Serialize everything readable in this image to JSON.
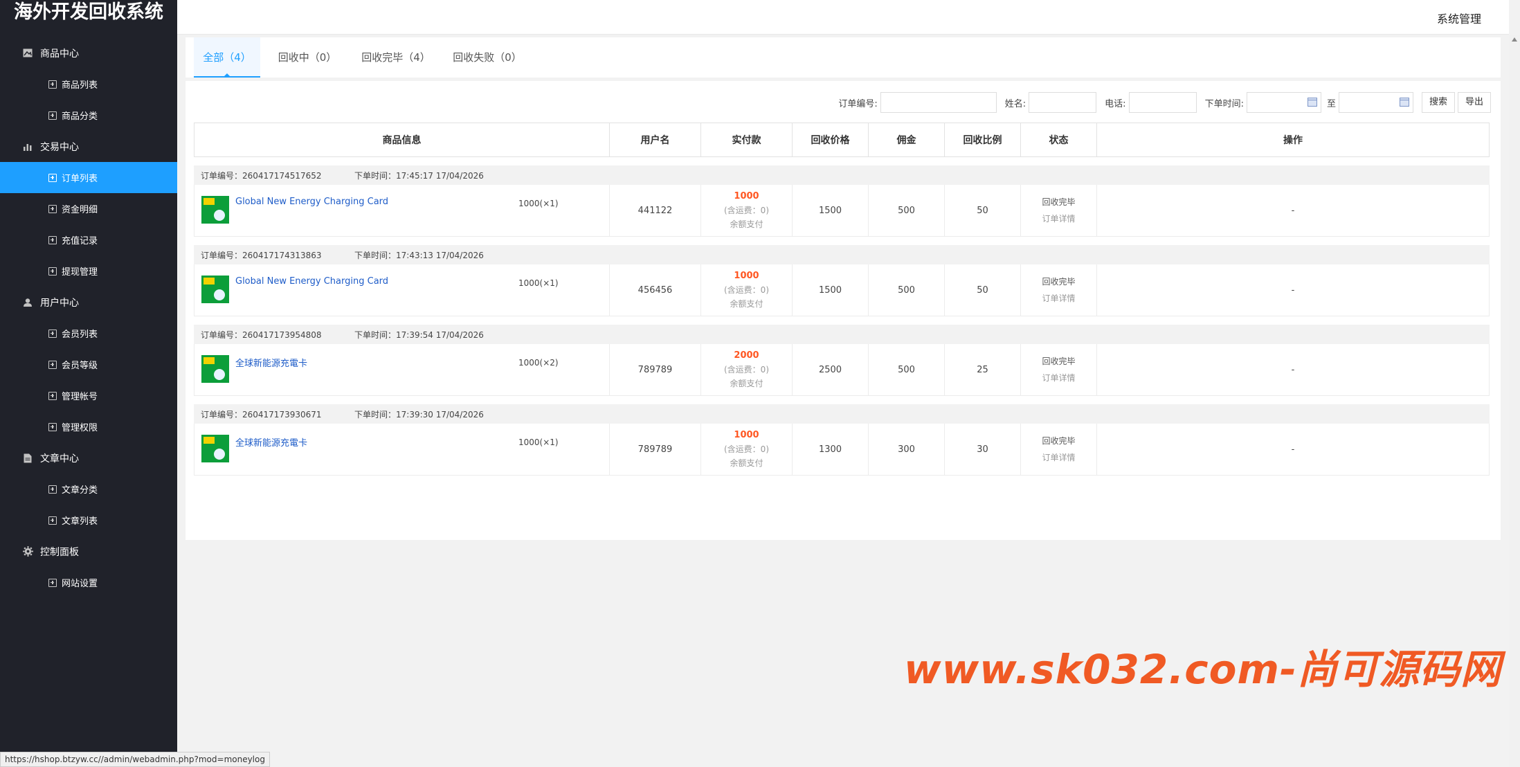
{
  "app": {
    "title": "海外开发回收系统",
    "header_right": "系统管理"
  },
  "sidebar": {
    "groups": [
      {
        "title": "商品中心",
        "icon": "image-icon",
        "items": [
          {
            "label": "商品列表"
          },
          {
            "label": "商品分类"
          }
        ]
      },
      {
        "title": "交易中心",
        "icon": "bar-chart-icon",
        "items": [
          {
            "label": "订单列表",
            "active": true
          },
          {
            "label": "资金明细"
          },
          {
            "label": "充值记录"
          },
          {
            "label": "提现管理"
          }
        ]
      },
      {
        "title": "用户中心",
        "icon": "user-icon",
        "items": [
          {
            "label": "会员列表"
          },
          {
            "label": "会员等级"
          },
          {
            "label": "管理帐号"
          },
          {
            "label": "管理权限"
          }
        ]
      },
      {
        "title": "文章中心",
        "icon": "document-icon",
        "items": [
          {
            "label": "文章分类"
          },
          {
            "label": "文章列表"
          }
        ]
      },
      {
        "title": "控制面板",
        "icon": "gear-icon",
        "items": [
          {
            "label": "网站设置"
          }
        ]
      }
    ]
  },
  "tabs": [
    {
      "label": "全部（4）",
      "active": true
    },
    {
      "label": "回收中（0）"
    },
    {
      "label": "回收完毕（4）"
    },
    {
      "label": "回收失败（0）"
    }
  ],
  "search": {
    "order_no_label": "订单编号:",
    "name_label": "姓名:",
    "phone_label": "电话:",
    "time_label": "下单时间:",
    "to_label": "至",
    "search_button": "搜索",
    "export_button": "导出"
  },
  "table": {
    "headers": [
      "商品信息",
      "用户名",
      "实付款",
      "回收价格",
      "佣金",
      "回收比例",
      "状态",
      "操作"
    ],
    "orders": [
      {
        "order_no_text": "订单编号：260417174517652",
        "time_text": "下单时间：17:45:17 17/04/2026",
        "product": "Global New Energy Charging Card",
        "qty": "1000(×1)",
        "username": "441122",
        "paid": "1000",
        "shipping": "(含运费：0)",
        "pay_method": "余额支付",
        "recycle_price": "1500",
        "commission": "500",
        "ratio": "50",
        "status": "回收完毕",
        "detail": "订单详情",
        "action": "-"
      },
      {
        "order_no_text": "订单编号：260417174313863",
        "time_text": "下单时间：17:43:13 17/04/2026",
        "product": "Global New Energy Charging Card",
        "qty": "1000(×1)",
        "username": "456456",
        "paid": "1000",
        "shipping": "(含运费：0)",
        "pay_method": "余额支付",
        "recycle_price": "1500",
        "commission": "500",
        "ratio": "50",
        "status": "回收完毕",
        "detail": "订单详情",
        "action": "-"
      },
      {
        "order_no_text": "订单编号：260417173954808",
        "time_text": "下单时间：17:39:54 17/04/2026",
        "product": "全球新能源充電卡",
        "qty": "1000(×2)",
        "username": "789789",
        "paid": "2000",
        "shipping": "(含运费：0)",
        "pay_method": "余额支付",
        "recycle_price": "2500",
        "commission": "500",
        "ratio": "25",
        "status": "回收完毕",
        "detail": "订单详情",
        "action": "-"
      },
      {
        "order_no_text": "订单编号：260417173930671",
        "time_text": "下单时间：17:39:30 17/04/2026",
        "product": "全球新能源充電卡",
        "qty": "1000(×1)",
        "username": "789789",
        "paid": "1000",
        "shipping": "(含运费：0)",
        "pay_method": "余额支付",
        "recycle_price": "1300",
        "commission": "300",
        "ratio": "30",
        "status": "回收完毕",
        "detail": "订单详情",
        "action": "-"
      }
    ]
  },
  "watermark": "www.sk032.com-尚可源码网",
  "status_url": "https://hshop.btzyw.cc//admin/webadmin.php?mod=moneylog"
}
